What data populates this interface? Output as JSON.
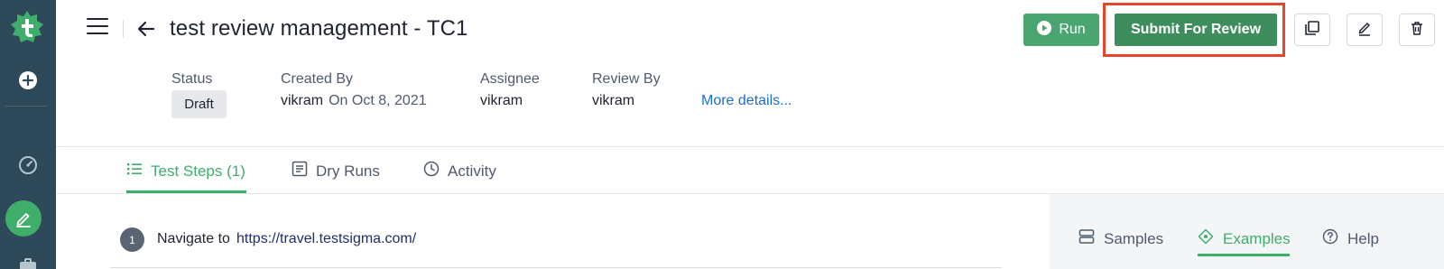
{
  "header": {
    "title": "test review management - TC1",
    "run_label": "Run",
    "submit_label": "Submit For Review"
  },
  "meta": {
    "status_label": "Status",
    "status_value": "Draft",
    "created_by_label": "Created By",
    "created_by_value": "vikram",
    "created_on": "On Oct 8, 2021",
    "assignee_label": "Assignee",
    "assignee_value": "vikram",
    "review_by_label": "Review By",
    "review_by_value": "vikram",
    "more_details": "More details..."
  },
  "tabs": [
    {
      "label": "Test Steps (1)",
      "icon": "list-icon",
      "active": true
    },
    {
      "label": "Dry Runs",
      "icon": "report-icon",
      "active": false
    },
    {
      "label": "Activity",
      "icon": "clock-icon",
      "active": false
    }
  ],
  "steps": [
    {
      "number": "1",
      "action": "Navigate to",
      "url": "https://travel.testsigma.com/"
    }
  ],
  "right_tabs": [
    {
      "label": "Samples",
      "icon": "samples-icon",
      "active": false
    },
    {
      "label": "Examples",
      "icon": "examples-icon",
      "active": true
    },
    {
      "label": "Help",
      "icon": "help-icon",
      "active": false
    }
  ],
  "colors": {
    "sidebar": "#2e4a5a",
    "accent_green": "#3fae6a",
    "submit_green": "#3e8e5d",
    "highlight_red": "#e4462b",
    "link_blue": "#1c6dd0"
  }
}
